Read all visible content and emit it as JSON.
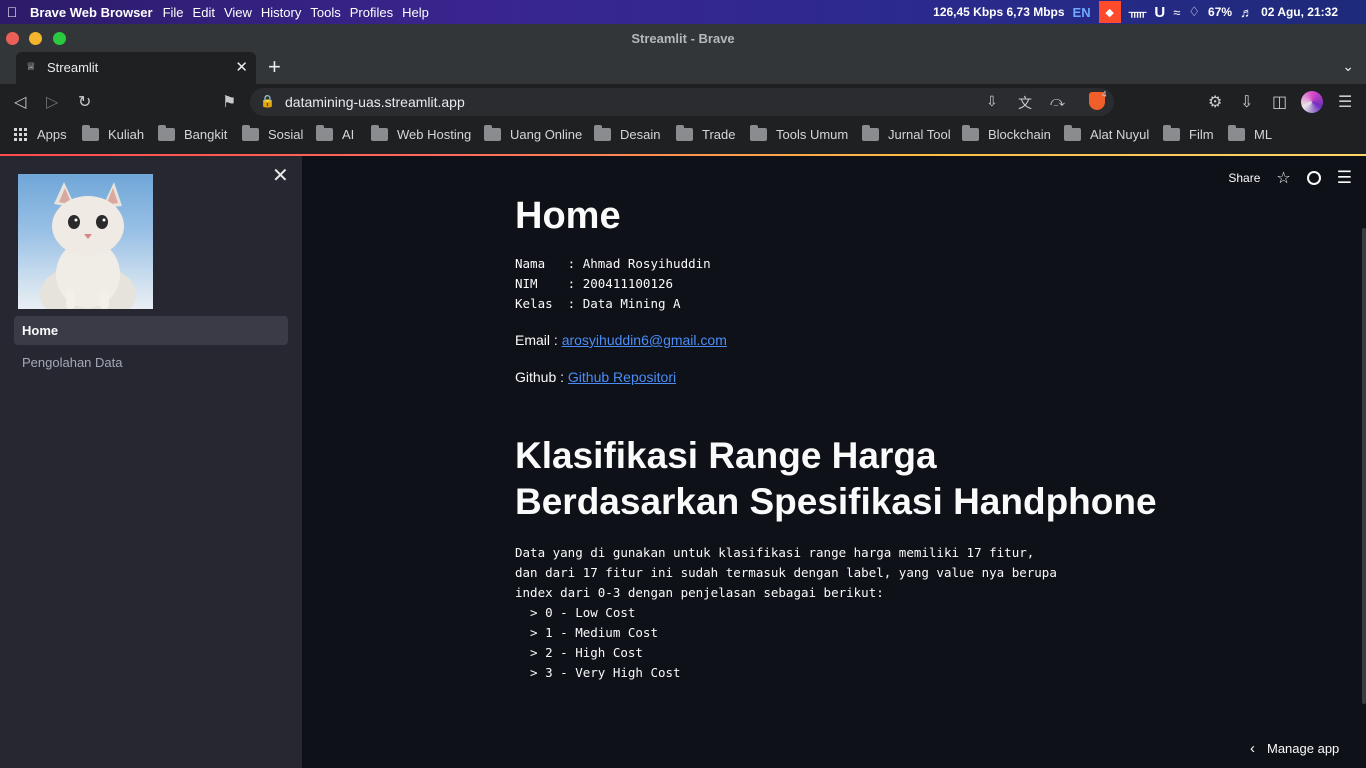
{
  "os_menubar": {
    "app_name": "Brave Web Browser",
    "menus": [
      "File",
      "Edit",
      "View",
      "History",
      "Tools",
      "Profiles",
      "Help"
    ],
    "net_speed": "126,45 Kbps 6,73 Mbps",
    "keyboard": "EN",
    "battery": "67%",
    "clock": "02 Agu, 21:32"
  },
  "window": {
    "title": "Streamlit - Brave"
  },
  "tab": {
    "label": "Streamlit"
  },
  "toolbar": {
    "url": "datamining-uas.streamlit.app",
    "shield_count": "4"
  },
  "bookmarks": [
    "Apps",
    "Kuliah",
    "Bangkit",
    "Sosial",
    "AI",
    "Web Hosting",
    "Uang Online",
    "Desain",
    "Trade",
    "Tools Umum",
    "Jurnal Tool",
    "Blockchain",
    "Alat Nuyul",
    "Film",
    "ML"
  ],
  "sidebar": {
    "nav": [
      {
        "label": "Home",
        "active": true
      },
      {
        "label": "Pengolahan Data",
        "active": false
      }
    ]
  },
  "header": {
    "share_label": "Share"
  },
  "content": {
    "title": "Home",
    "info_block": "Nama   : Ahmad Rosyihuddin\nNIM    : 200411100126\nKelas  : Data Mining A",
    "email_label": "Email : ",
    "email_link": "arosyihuddin6@gmail.com",
    "github_label": "Github : ",
    "github_link": "Github Repositori",
    "section_title": "Klasifikasi Range Harga Berdasarkan Spesifikasi Handphone",
    "description_block": "Data yang di gunakan untuk klasifikasi range harga memiliki 17 fitur,\ndan dari 17 fitur ini sudah termasuk dengan label, yang value nya berupa\nindex dari 0-3 dengan penjelasan sebagai berikut:\n  > 0 - Low Cost\n  > 1 - Medium Cost\n  > 2 - High Cost\n  > 3 - Very High Cost"
  },
  "footer": {
    "manage_label": "Manage app"
  },
  "colors": {
    "accent": "#ff4b4b",
    "link": "#4b8df8",
    "sidebar_bg": "#262730",
    "main_bg": "#0e1117"
  }
}
